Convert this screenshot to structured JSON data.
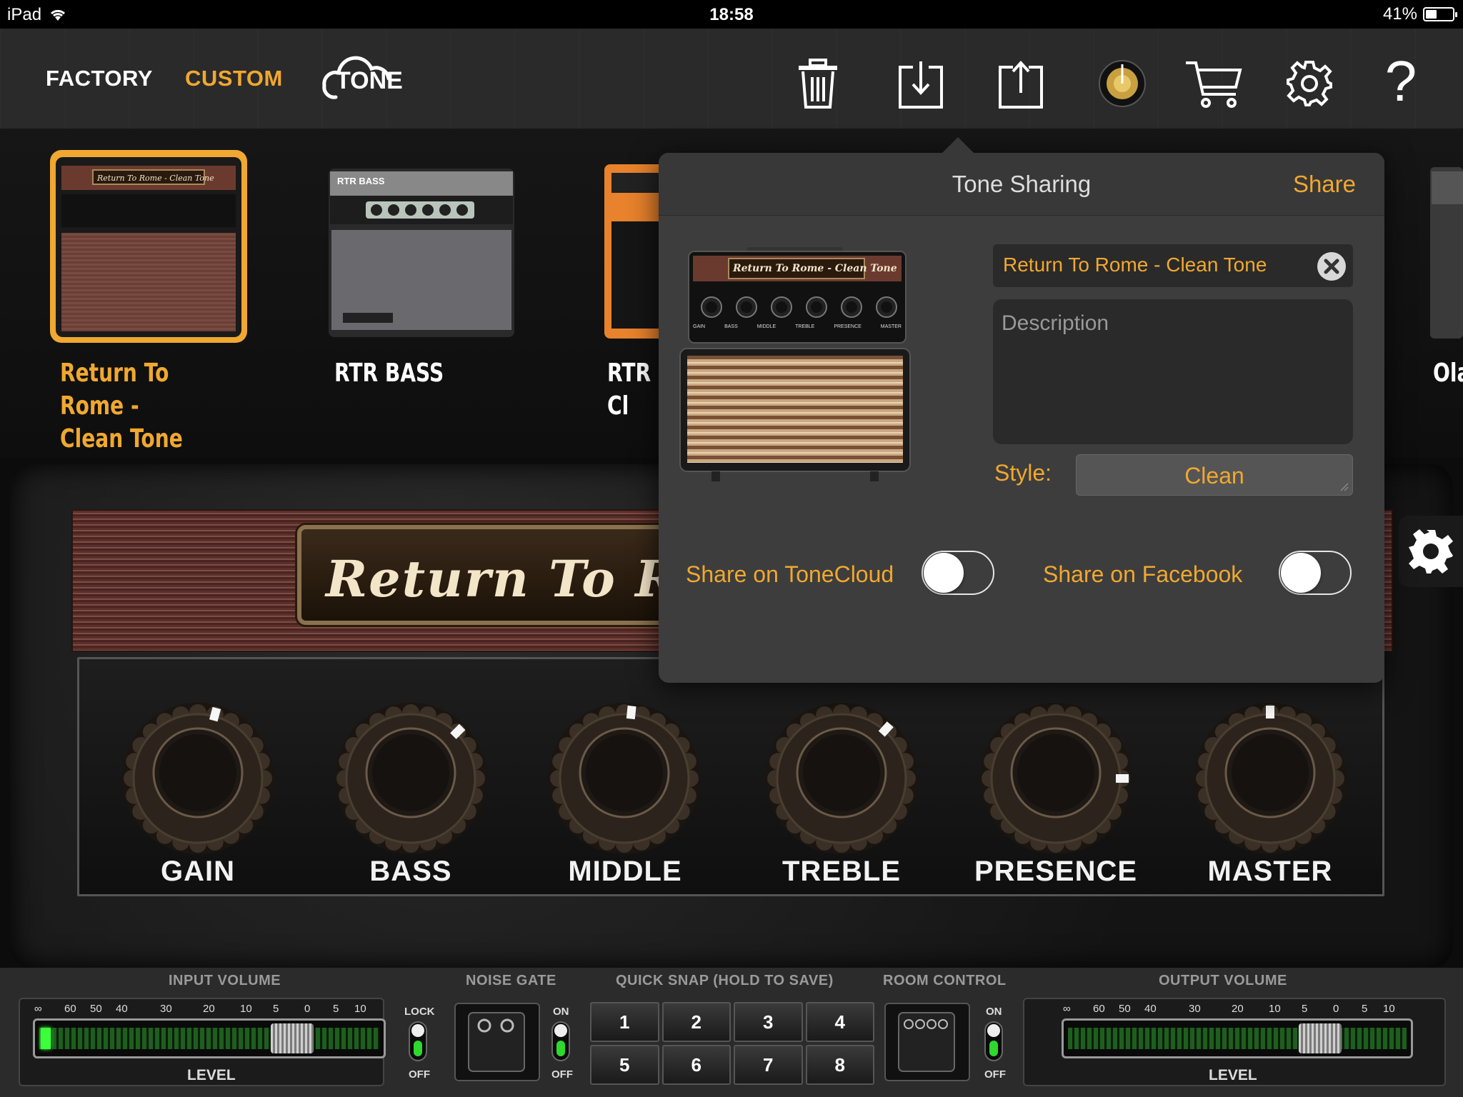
{
  "status": {
    "device": "iPad",
    "time": "18:58",
    "battery": "41%",
    "battery_level": 0.41
  },
  "toolbar": {
    "tabs": [
      {
        "label": "FACTORY"
      },
      {
        "label": "CUSTOM"
      }
    ],
    "tonecloud_label": "TONE",
    "icons": [
      "trash-icon",
      "download-icon",
      "upload-icon",
      "amp-knob-icon",
      "cart-icon",
      "gear-icon",
      "help-icon"
    ],
    "help_glyph": "?"
  },
  "presets": [
    {
      "name_line1": "Return To Rome -",
      "name_line2": "Clean Tone",
      "amp_label": "Return To Rome - Clean Tone",
      "selected": true
    },
    {
      "name_line1": "RTR BASS",
      "name_line2": "",
      "amp_label": "RTR BASS",
      "selected": false
    },
    {
      "name_line1": "RTR Cl",
      "name_line2": "",
      "amp_label": "",
      "selected": false
    },
    {
      "name_line1": "Ola",
      "name_line2": "",
      "amp_label": "",
      "selected": false
    }
  ],
  "amp": {
    "name_plate": "Return  To  R",
    "knobs": [
      {
        "label": "GAIN",
        "value": 0.55
      },
      {
        "label": "BASS",
        "value": 0.65
      },
      {
        "label": "MIDDLE",
        "value": 0.52
      },
      {
        "label": "TREBLE",
        "value": 0.64
      },
      {
        "label": "PRESENCE",
        "value": 0.8
      },
      {
        "label": "MASTER",
        "value": 0.5
      }
    ]
  },
  "popover": {
    "title": "Tone Sharing",
    "share_button": "Share",
    "tone_name": "Return To Rome - Clean Tone",
    "description_placeholder": "Description",
    "style_label": "Style:",
    "style_value": "Clean",
    "share_tonecloud_label": "Share on ToneCloud",
    "share_facebook_label": "Share on Facebook",
    "mini_amp_plate": "Return To Rome - Clean Tone",
    "mini_amp_knobs": [
      "GAIN",
      "BASS",
      "MIDDLE",
      "TREBLE",
      "PRESENCE",
      "MASTER"
    ]
  },
  "bottom": {
    "input_volume": {
      "title": "INPUT VOLUME",
      "scale": [
        "∞",
        "60",
        "50",
        "40",
        "30",
        "20",
        "10",
        "5",
        "0",
        "5",
        "10"
      ],
      "level_label": "LEVEL",
      "slider_value": 0.78,
      "signal": 0.03
    },
    "lock": {
      "top": "LOCK",
      "bottom": "OFF"
    },
    "noise_gate": {
      "title": "NOISE GATE",
      "on": "ON",
      "off": "OFF"
    },
    "quick_snap": {
      "title": "QUICK SNAP (HOLD TO SAVE)",
      "slots": [
        "1",
        "2",
        "3",
        "4",
        "5",
        "6",
        "7",
        "8"
      ]
    },
    "room_control": {
      "title": "ROOM CONTROL",
      "on": "ON",
      "off": "OFF"
    },
    "output_volume": {
      "title": "OUTPUT VOLUME",
      "scale": [
        "∞",
        "60",
        "50",
        "40",
        "30",
        "20",
        "10",
        "5",
        "0",
        "5",
        "10"
      ],
      "level_label": "LEVEL",
      "slider_value": 0.78
    }
  },
  "colors": {
    "accent": "#f0a830",
    "popover_bg": "#3d3d3d",
    "meter_green": "#3bff3b"
  }
}
